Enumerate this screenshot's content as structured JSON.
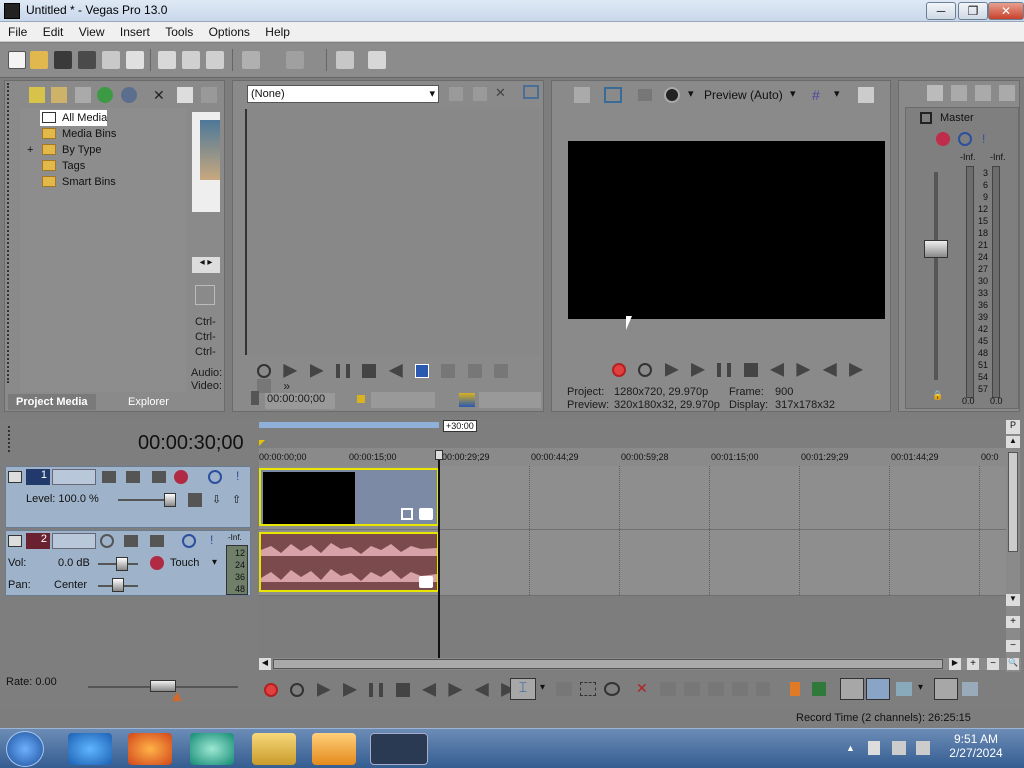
{
  "window": {
    "title": "Untitled * - Vegas Pro 13.0",
    "min": "─",
    "max": "❐",
    "close": "✕"
  },
  "menu": [
    "File",
    "Edit",
    "View",
    "Insert",
    "Tools",
    "Options",
    "Help"
  ],
  "project_media": {
    "tree": [
      "All Media",
      "Media Bins",
      "By Type",
      "Tags",
      "Smart Bins"
    ],
    "expand": "+",
    "tabs": [
      "Project Media",
      "Explorer"
    ],
    "side_labels": [
      "Ctrl-",
      "Ctrl-",
      "Ctrl-",
      "Audio:",
      "Video:"
    ],
    "scroll": "◂ ▸"
  },
  "trimmer": {
    "preset": "(None)",
    "timecode": "00:00:00;00"
  },
  "preview": {
    "mode": "Preview (Auto)",
    "project_label": "Project:",
    "project_value": "1280x720, 29.970p",
    "frame_label": "Frame:",
    "frame_value": "900",
    "preview_label": "Preview:",
    "preview_value": "320x180x32, 29.970p",
    "display_label": "Display:",
    "display_value": "317x178x32"
  },
  "mixer": {
    "master": "Master",
    "inf_left": "-Inf.",
    "inf_right": "-Inf.",
    "scale": [
      "3",
      "6",
      "9",
      "12",
      "15",
      "18",
      "21",
      "24",
      "27",
      "30",
      "33",
      "36",
      "39",
      "42",
      "45",
      "48",
      "51",
      "54",
      "57"
    ],
    "bottom_left": "0.0",
    "bottom_right": "0.0"
  },
  "timeline": {
    "timecode": "00:00:30;00",
    "length_badge": "+30:00",
    "ruler": [
      "00:00:00;00",
      "00:00:15;00",
      "00:00:29;29",
      "00:00:44;29",
      "00:00:59;28",
      "00:01:15;00",
      "00:01:29;29",
      "00:01:44;29",
      "00:0"
    ],
    "video_track": {
      "number": "1",
      "level": "Level: 100.0 %"
    },
    "audio_track": {
      "number": "2",
      "vol_label": "Vol:",
      "vol_value": "0.0 dB",
      "pan_label": "Pan:",
      "pan_value": "Center",
      "mode": "Touch",
      "meter_inf": "-Inf.",
      "meter": [
        "12",
        "24",
        "36",
        "48"
      ]
    },
    "rate": "Rate: 0.00",
    "record_time": "Record Time (2 channels): 26:25:15"
  },
  "taskbar": {
    "time": "9:51 AM",
    "date": "2/27/2024"
  },
  "colors": {
    "accent": "#e6e600",
    "audio_clip": "#7b4a4d",
    "video_clip": "#7c8aa6",
    "track_header": "#9eb2c9"
  }
}
